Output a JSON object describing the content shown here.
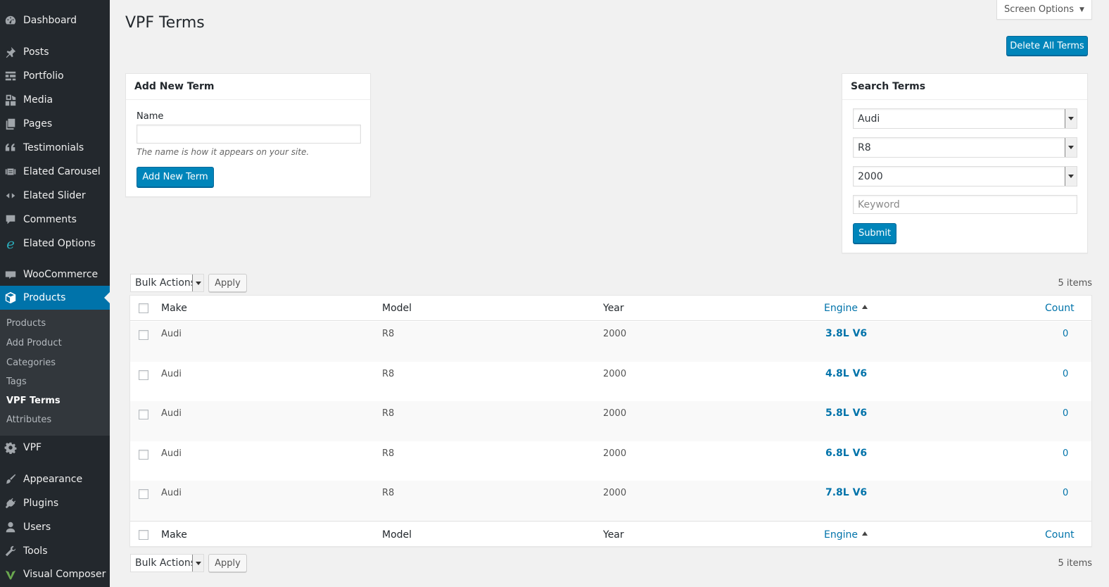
{
  "sidebar": {
    "items": [
      {
        "label": "Dashboard",
        "icon": "dashboard-icon"
      },
      {
        "label": "Posts",
        "icon": "pushpin-icon"
      },
      {
        "label": "Portfolio",
        "icon": "grid-icon"
      },
      {
        "label": "Media",
        "icon": "media-icon"
      },
      {
        "label": "Pages",
        "icon": "pages-icon"
      },
      {
        "label": "Testimonials",
        "icon": "quote-icon"
      },
      {
        "label": "Elated Carousel",
        "icon": "carousel-icon"
      },
      {
        "label": "Elated Slider",
        "icon": "slider-icon"
      },
      {
        "label": "Comments",
        "icon": "comment-icon"
      },
      {
        "label": "Elated Options",
        "icon": "elated-icon"
      },
      {
        "label": "WooCommerce",
        "icon": "woo-icon"
      },
      {
        "label": "Products",
        "icon": "products-icon"
      },
      {
        "label": "VPF",
        "icon": "gear-icon"
      },
      {
        "label": "Appearance",
        "icon": "brush-icon"
      },
      {
        "label": "Plugins",
        "icon": "plug-icon"
      },
      {
        "label": "Users",
        "icon": "user-icon"
      },
      {
        "label": "Tools",
        "icon": "wrench-icon"
      },
      {
        "label": "Visual Composer",
        "icon": "vc-icon"
      }
    ],
    "submenu": [
      "Products",
      "Add Product",
      "Categories",
      "Tags",
      "VPF Terms",
      "Attributes"
    ],
    "current_submenu": "VPF Terms",
    "accent": "#0073aa"
  },
  "page": {
    "title": "VPF Terms",
    "screen_options": "Screen Options",
    "delete_all": "Delete All Terms"
  },
  "add_term": {
    "heading": "Add New Term",
    "name_label": "Name",
    "name_value": "",
    "description": "The name is how it appears on your site.",
    "button": "Add New Term"
  },
  "search": {
    "heading": "Search Terms",
    "make": "Audi",
    "model": "R8",
    "year": "2000",
    "keyword_placeholder": "Keyword",
    "submit": "Submit"
  },
  "tablenav": {
    "bulk_actions": "Bulk Actions",
    "apply": "Apply",
    "items_count": "5 items"
  },
  "table": {
    "columns": {
      "make": "Make",
      "model": "Model",
      "year": "Year",
      "engine": "Engine",
      "count": "Count"
    },
    "rows": [
      {
        "make": "Audi",
        "model": "R8",
        "year": "2000",
        "engine": "3.8L V6",
        "count": "0"
      },
      {
        "make": "Audi",
        "model": "R8",
        "year": "2000",
        "engine": "4.8L V6",
        "count": "0"
      },
      {
        "make": "Audi",
        "model": "R8",
        "year": "2000",
        "engine": "5.8L V6",
        "count": "0"
      },
      {
        "make": "Audi",
        "model": "R8",
        "year": "2000",
        "engine": "6.8L V6",
        "count": "0"
      },
      {
        "make": "Audi",
        "model": "R8",
        "year": "2000",
        "engine": "7.8L V6",
        "count": "0"
      }
    ]
  }
}
